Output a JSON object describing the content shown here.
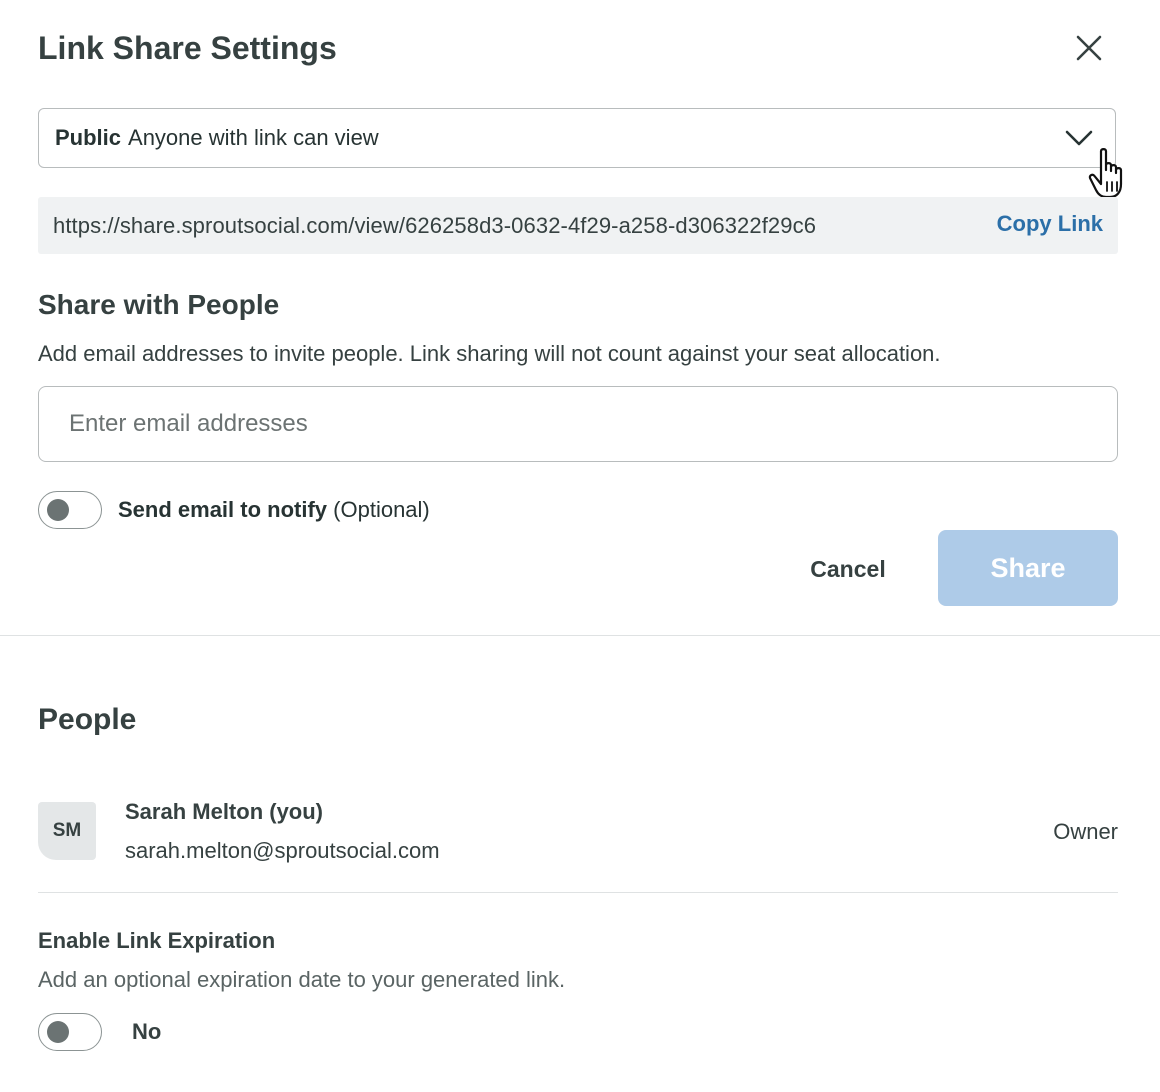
{
  "dialog": {
    "title": "Link Share Settings",
    "close_icon": "close-icon"
  },
  "access_select": {
    "selected_strong": "Public",
    "selected_text": "Anyone with link can view",
    "icon": "chevron-down-icon"
  },
  "link": {
    "url": "https://share.sproutsocial.com/view/626258d3-0632-4f29-a258-d306322f29c6",
    "copy_label": "Copy Link"
  },
  "share_people": {
    "heading": "Share with People",
    "description": "Add email addresses to invite people. Link sharing will not count against your seat allocation.",
    "email_placeholder": "Enter email addresses",
    "email_value": "",
    "notify_label": "Send email to notify",
    "notify_optional": "(Optional)",
    "notify_enabled": false,
    "cancel_label": "Cancel",
    "share_label": "Share"
  },
  "people": {
    "heading": "People",
    "members": [
      {
        "initials": "SM",
        "name": "Sarah Melton (you)",
        "email": "sarah.melton@sproutsocial.com",
        "role": "Owner"
      }
    ]
  },
  "expiration": {
    "title": "Enable Link Expiration",
    "description": "Add an optional expiration date to your generated link.",
    "enabled": false,
    "state_label": "No"
  },
  "colors": {
    "link_blue": "#2b6fa8",
    "share_button_disabled": "#aecbe8",
    "text_dark": "#364141",
    "link_bar_bg": "#f0f2f3"
  }
}
